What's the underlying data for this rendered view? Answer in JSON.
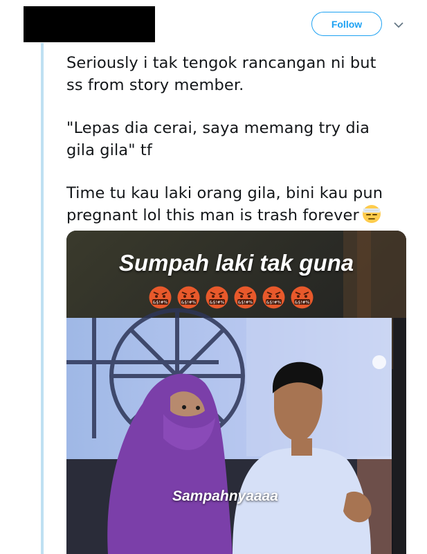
{
  "header": {
    "follow_label": "Follow",
    "menu_icon": "chevron-down-icon",
    "accent_color": "#1da1f2"
  },
  "tweet": {
    "paragraphs": [
      "Seriously i tak tengok rancangan ni but\nss from story member.",
      "\"Lepas dia cerai, saya memang try dia\ngila gila\" tf",
      "Time tu kau laki orang gila, bini kau pun\npregnant lol this man is trash forever"
    ],
    "trailing_emoji": "unamused-bandage-face-emoji"
  },
  "media": {
    "caption_top": "Sumpah laki tak guna",
    "emoji_row_icon": "face-with-symbols-on-mouth-emoji",
    "emoji_row_count": 6,
    "caption_bottom": "Sampahnyaaaa"
  }
}
